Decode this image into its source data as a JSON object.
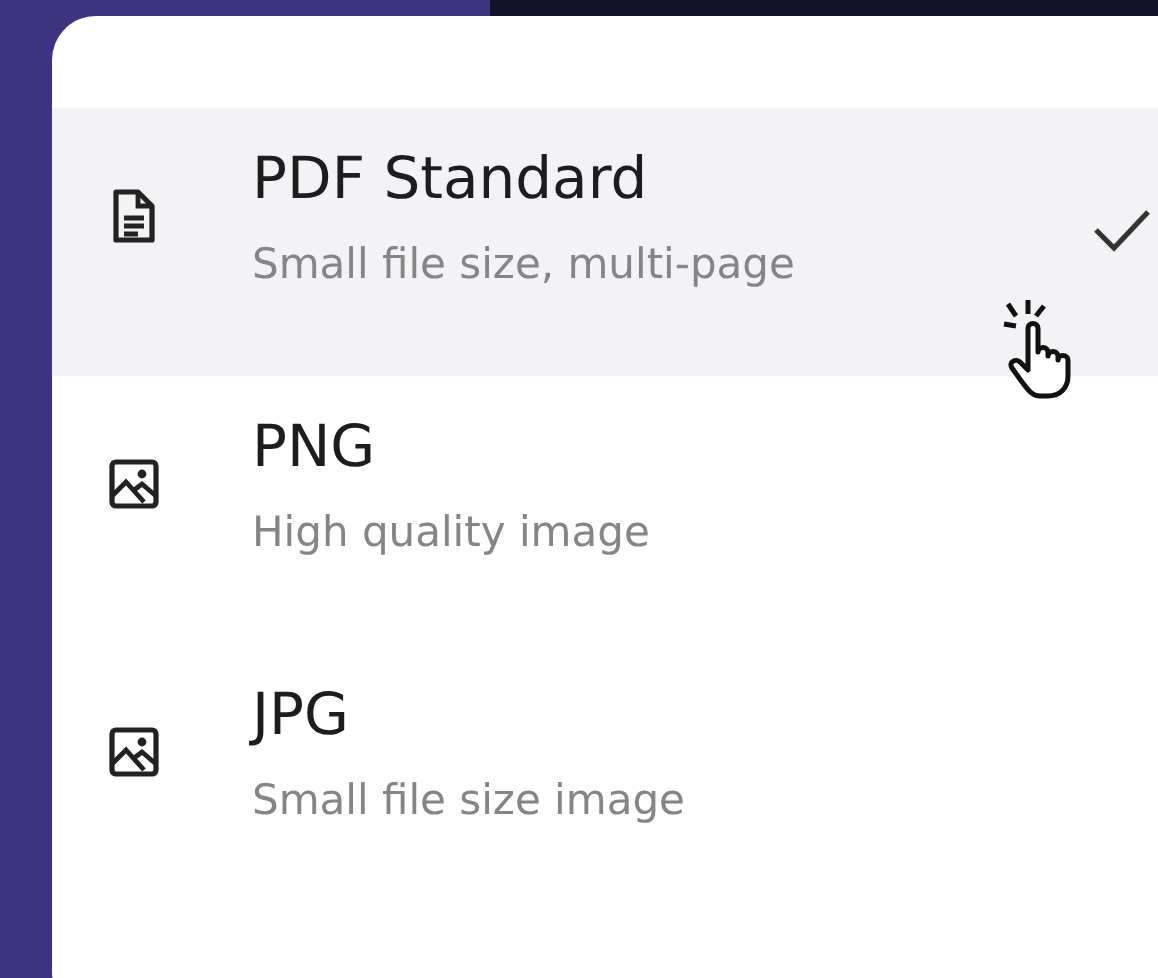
{
  "options": [
    {
      "kind": "document",
      "title": "PDF Standard",
      "subtitle": "Small file size, multi-page",
      "selected": true
    },
    {
      "kind": "image",
      "title": "PNG",
      "subtitle": "High quality image",
      "selected": false
    },
    {
      "kind": "image",
      "title": "JPG",
      "subtitle": "Small file size image",
      "selected": false
    }
  ]
}
